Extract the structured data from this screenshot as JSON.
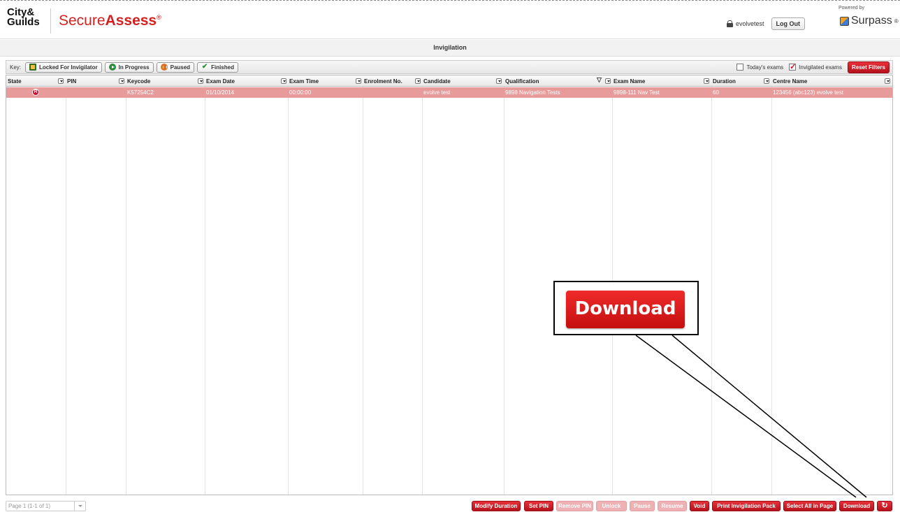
{
  "header": {
    "logo_city": "City&",
    "logo_guilds": "Guilds",
    "app_name_light": "Secure",
    "app_name_bold": "Assess",
    "app_name_mark": "®",
    "username": "evolvetest",
    "logout_label": "Log Out",
    "powered_by": "Powered by",
    "surpass_label": "Surpass",
    "surpass_mark": "®"
  },
  "page_title": "Invigilation",
  "key_bar": {
    "key_label": "Key:",
    "items": [
      {
        "label": "Locked For Invigilator",
        "icon": "locked-icon"
      },
      {
        "label": "In Progress",
        "icon": "play-icon"
      },
      {
        "label": "Paused",
        "icon": "pause-icon"
      },
      {
        "label": "Finished",
        "icon": "check-icon"
      }
    ],
    "filters": {
      "todays_exams_label": "Today's exams",
      "todays_exams_checked": false,
      "invigilated_exams_label": "Invigilated exams",
      "invigilated_exams_checked": true,
      "reset_filters_label": "Reset Filters"
    }
  },
  "grid": {
    "columns": [
      "State",
      "PIN",
      "Keycode",
      "Exam Date",
      "Exam Time",
      "Enrolment No.",
      "Candidate",
      "Qualification",
      "Exam Name",
      "Duration",
      "Centre Name"
    ],
    "rows": [
      {
        "state": "R",
        "pin": "",
        "keycode": "K57254C2",
        "exam_date": "01/10/2014",
        "exam_time": "00:00:00",
        "enrolment_no": "",
        "candidate": "evolve test",
        "qualification": "9898 Navigation Tests",
        "exam_name": "9898-111 Nav Test",
        "duration": "60",
        "centre_name": "123456 (abc123) evolve test"
      }
    ]
  },
  "footer": {
    "pager_text": "Page 1 (1-1 of 1)",
    "buttons": [
      {
        "label": "Modify Duration",
        "enabled": true
      },
      {
        "label": "Set PIN",
        "enabled": true
      },
      {
        "label": "Remove PIN",
        "enabled": false
      },
      {
        "label": "Unlock",
        "enabled": false
      },
      {
        "label": "Pause",
        "enabled": false
      },
      {
        "label": "Resume",
        "enabled": false
      },
      {
        "label": "Void",
        "enabled": true
      },
      {
        "label": "Print Invigilation Pack",
        "enabled": true
      },
      {
        "label": "Select All in Page",
        "enabled": true
      },
      {
        "label": "Download",
        "enabled": true
      }
    ],
    "refresh_icon": "refresh-icon"
  },
  "callout": {
    "label": "Download"
  },
  "colors": {
    "brand_red": "#c8102e",
    "row_highlight": "#e89b9b",
    "disabled_button": "#eeb1b4"
  }
}
